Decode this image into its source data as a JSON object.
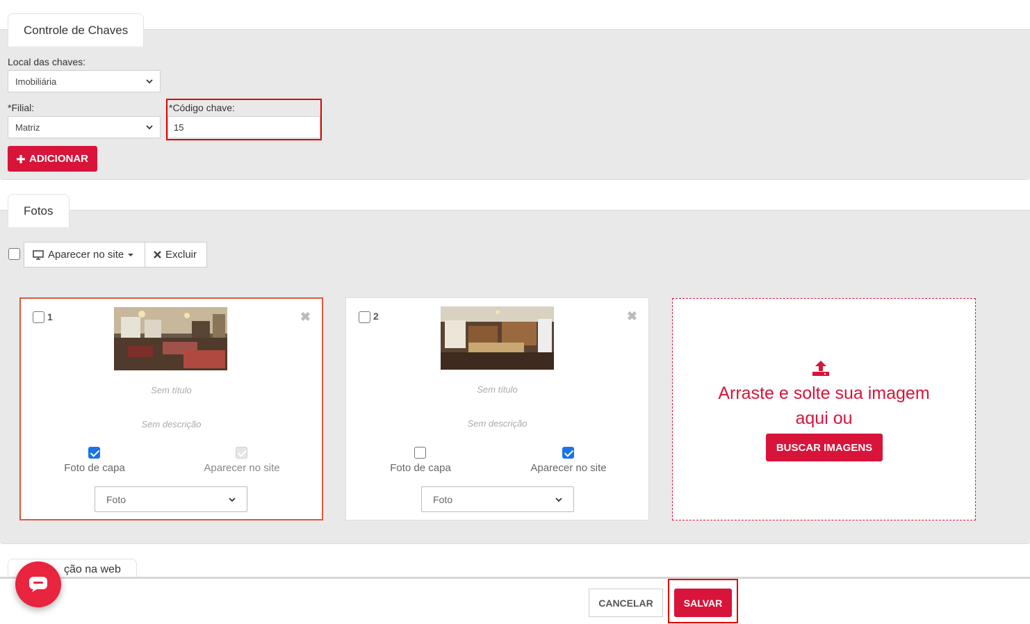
{
  "keys_section": {
    "tab_label": "Controle de Chaves",
    "local_label": "Local das chaves:",
    "local_value": "Imobiliária",
    "filial_label": "*Filial:",
    "filial_value": "Matriz",
    "codigo_label": "*Código chave:",
    "codigo_value": "15",
    "add_button": "ADICIONAR"
  },
  "photos_section": {
    "tab_label": "Fotos",
    "toolbar": {
      "show_on_site": "Aparecer no site",
      "delete": "Excluir"
    },
    "cards": [
      {
        "number": "1",
        "title": "Sem título",
        "description": "Sem descrição",
        "cover_label": "Foto de capa",
        "cover_checked": true,
        "site_label": "Aparecer no site",
        "site_checked": true,
        "type_value": "Foto"
      },
      {
        "number": "2",
        "title": "Sem título",
        "description": "Sem descrição",
        "cover_label": "Foto de capa",
        "cover_checked": false,
        "site_label": "Aparecer no site",
        "site_checked": true,
        "type_value": "Foto"
      }
    ],
    "dropzone": {
      "line1": "Arraste e solte sua imagem",
      "line2": "aqui ou",
      "button": "BUSCAR IMAGENS"
    }
  },
  "next_section": {
    "tab_label_partial": "ção na web"
  },
  "footer": {
    "cancel": "CANCELAR",
    "save": "SALVAR"
  },
  "colors": {
    "accent": "#d8143a",
    "highlight_box": "#e00000",
    "checkbox_blue": "#1a73e8"
  }
}
